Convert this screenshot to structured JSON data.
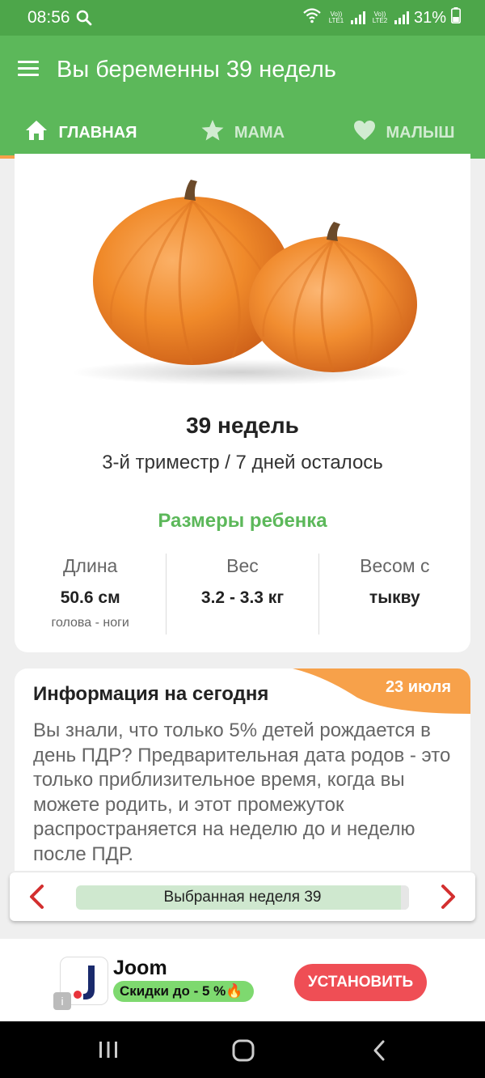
{
  "status_bar": {
    "time": "08:56",
    "sim1_label": "Vo)) LTE1",
    "sim2_label": "Vo)) LTE2",
    "battery": "31%",
    "icons": [
      "search-icon",
      "wifi-icon",
      "signal-icon",
      "battery-icon"
    ]
  },
  "app_bar": {
    "title": "Вы беременны 39 недель",
    "menu_icon": "hamburger-menu-icon"
  },
  "tabs": [
    {
      "label": "ГЛАВНАЯ",
      "icon": "home-icon",
      "active": true
    },
    {
      "label": "МАМА",
      "icon": "star-icon",
      "active": false
    },
    {
      "label": "МАЛЫШ",
      "icon": "heart-icon",
      "active": false
    }
  ],
  "week_card": {
    "image": "pumpkin-image",
    "week_title": "39 недель",
    "trimester": "3-й триместр / 7 дней осталось",
    "sizes_title": "Размеры ребенка",
    "sizes": [
      {
        "label": "Длина",
        "value": "50.6 см",
        "note": "голова - ноги"
      },
      {
        "label": "Вес",
        "value": "3.2 - 3.3 кг",
        "note": ""
      },
      {
        "label": "Весом с",
        "value": "тыкву",
        "note": ""
      }
    ]
  },
  "info_card": {
    "title": "Информация на сегодня",
    "date": "23 июля",
    "body": "Вы знали, что только 5% детей рождается в день ПДР? Предварительная дата родов - это только приблизительное время, когда вы можете родить, и этот промежуток распространяется на неделю до и неделю после ПДР."
  },
  "week_nav": {
    "label": "Выбранная неделя 39",
    "prev_icon": "chevron-left-icon",
    "next_icon": "chevron-right-icon"
  },
  "ad": {
    "app_name": "Joom",
    "promo": "Скидки до - 5 %🔥",
    "button": "УСТАНОВИТЬ",
    "info_badge": "i"
  },
  "colors": {
    "status_green": "#4da64a",
    "primary_green": "#5cb85a",
    "accent_orange": "#f7a14a",
    "arrow_red": "#d32f2f",
    "ad_button": "#ef4e55"
  }
}
